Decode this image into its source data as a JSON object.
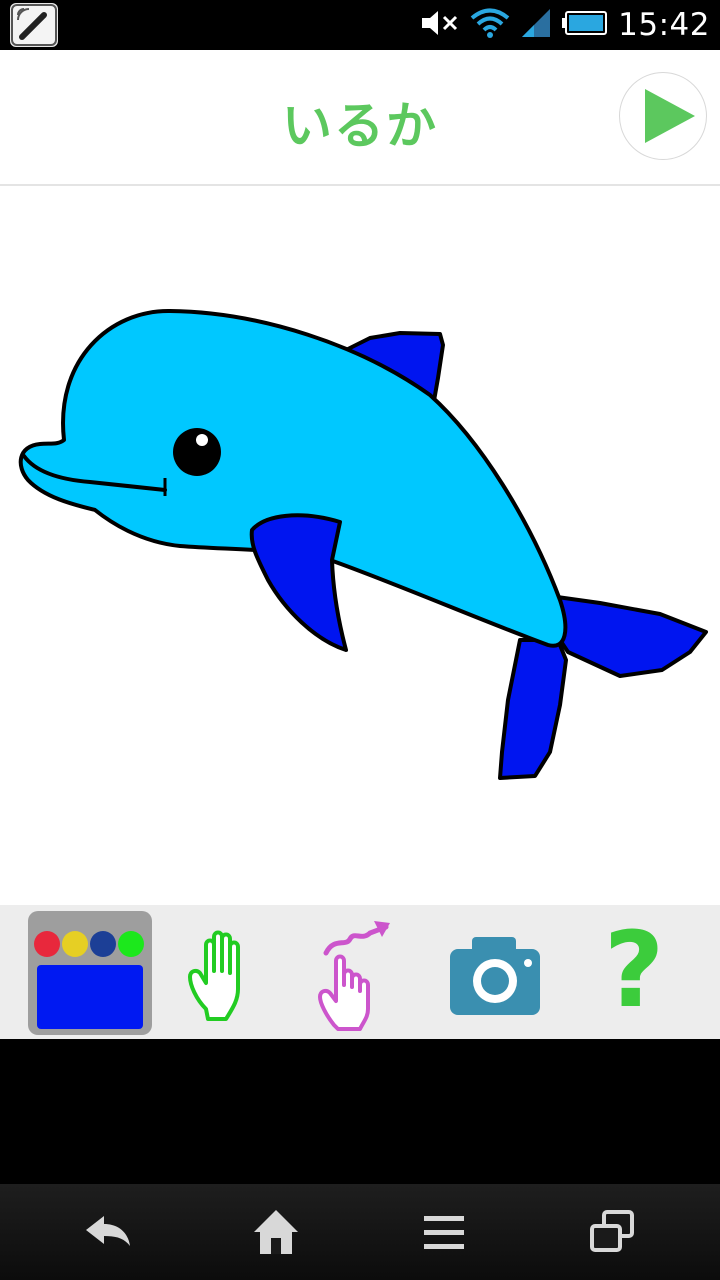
{
  "status_bar": {
    "time": "15:42",
    "icons": [
      "pen-app-icon",
      "mute-icon",
      "wifi-icon",
      "signal-icon",
      "battery-icon"
    ]
  },
  "header": {
    "title": "いるか",
    "play_icon": "play-icon"
  },
  "canvas": {
    "drawing": "dolphin-coloring-picture",
    "colors": {
      "body": "#00c8ff",
      "fins": "#0015f0",
      "outline": "#000000"
    }
  },
  "toolbar": {
    "palette_dots": [
      "#e8283c",
      "#e6cf24",
      "#1c3f96",
      "#1ce81c"
    ],
    "current_color": "#0019f2",
    "tools": [
      "palette-tool",
      "hand-icon",
      "swipe-gesture-icon",
      "camera-icon",
      "help-icon"
    ],
    "help_label": "?"
  },
  "nav_bar": {
    "buttons": [
      "back-icon",
      "home-icon",
      "menu-icon",
      "recent-apps-icon"
    ]
  }
}
